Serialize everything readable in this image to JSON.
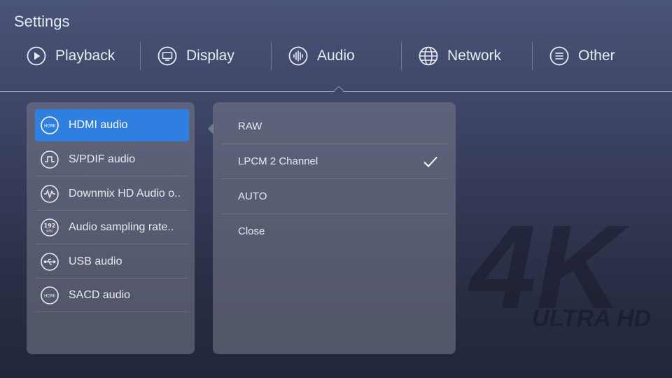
{
  "page": {
    "title": "Settings"
  },
  "tabs": [
    {
      "label": "Playback",
      "icon": "play-icon"
    },
    {
      "label": "Display",
      "icon": "monitor-icon"
    },
    {
      "label": "Audio",
      "icon": "audio-wave-icon",
      "selected": true
    },
    {
      "label": "Network",
      "icon": "globe-icon"
    },
    {
      "label": "Other",
      "icon": "list-icon"
    }
  ],
  "audio_menu": {
    "items": [
      {
        "label": "HDMI audio",
        "icon": "hdmi-icon",
        "selected": true
      },
      {
        "label": "S/PDIF audio",
        "icon": "spdif-icon"
      },
      {
        "label": "Downmix HD Audio o..",
        "icon": "waveform-icon"
      },
      {
        "label": "Audio sampling rate..",
        "icon": "192khz-icon"
      },
      {
        "label": "USB audio",
        "icon": "usb-icon"
      },
      {
        "label": "SACD audio",
        "icon": "hdmi-icon"
      }
    ]
  },
  "options": {
    "items": [
      {
        "label": "RAW",
        "checked": false
      },
      {
        "label": "LPCM 2 Channel",
        "checked": true
      },
      {
        "label": "AUTO",
        "checked": false
      },
      {
        "label": "Close",
        "checked": false
      }
    ]
  },
  "watermark": {
    "big": "4K",
    "small": "ULTRA HD"
  },
  "colors": {
    "accent": "#2f7fe0",
    "background_top": "#4a5478",
    "background_bottom": "#22263a"
  }
}
